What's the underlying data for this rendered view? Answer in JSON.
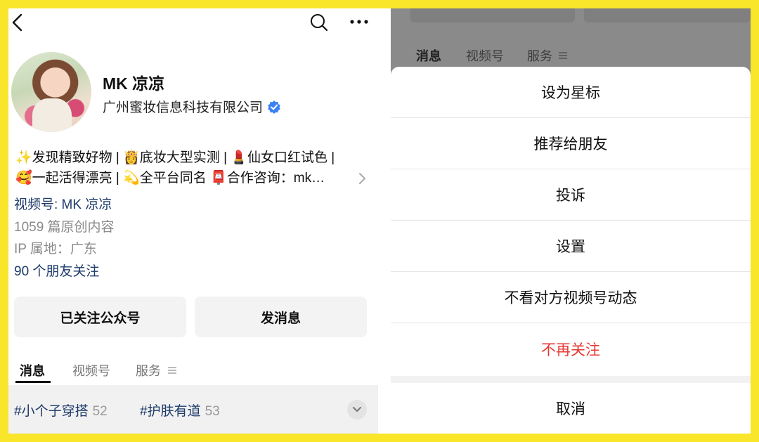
{
  "profile": {
    "name": "MK 凉凉",
    "company": "广州蜜妆信息科技有限公司",
    "bio_line1": "✨发现精致好物 | 👸底妆大型实测 | 💄仙女口红试色 |",
    "bio_line2": "🥰一起活得漂亮 | 💫全平台同名 📮合作咨询：mk…",
    "channels_link": "视频号: MK 凉凉",
    "original_count": "1059 篇原创内容",
    "ip_location": "IP 属地：广东",
    "friends_following": "90 个朋友关注"
  },
  "actions": {
    "followed_label": "已关注公众号",
    "message_label": "发消息"
  },
  "tabs": [
    {
      "label": "消息"
    },
    {
      "label": "视频号"
    },
    {
      "label": "服务"
    }
  ],
  "tags": [
    {
      "label": "#小个子穿搭",
      "count": "52"
    },
    {
      "label": "#护肤有道",
      "count": "53"
    }
  ],
  "sheet": {
    "items": [
      {
        "label": "设为星标"
      },
      {
        "label": "推荐给朋友"
      },
      {
        "label": "投诉"
      },
      {
        "label": "设置"
      },
      {
        "label": "不看对方视频号动态"
      },
      {
        "label": "不再关注"
      }
    ],
    "cancel_label": "取消"
  },
  "icons": {
    "back": "chevron-left-icon",
    "search": "search-icon",
    "more": "more-dots-icon",
    "verified": "verified-badge-icon"
  },
  "colors": {
    "frame": "#f9e52a",
    "link": "#1d3a69",
    "danger": "#e53935",
    "verified": "#3b82f6"
  }
}
